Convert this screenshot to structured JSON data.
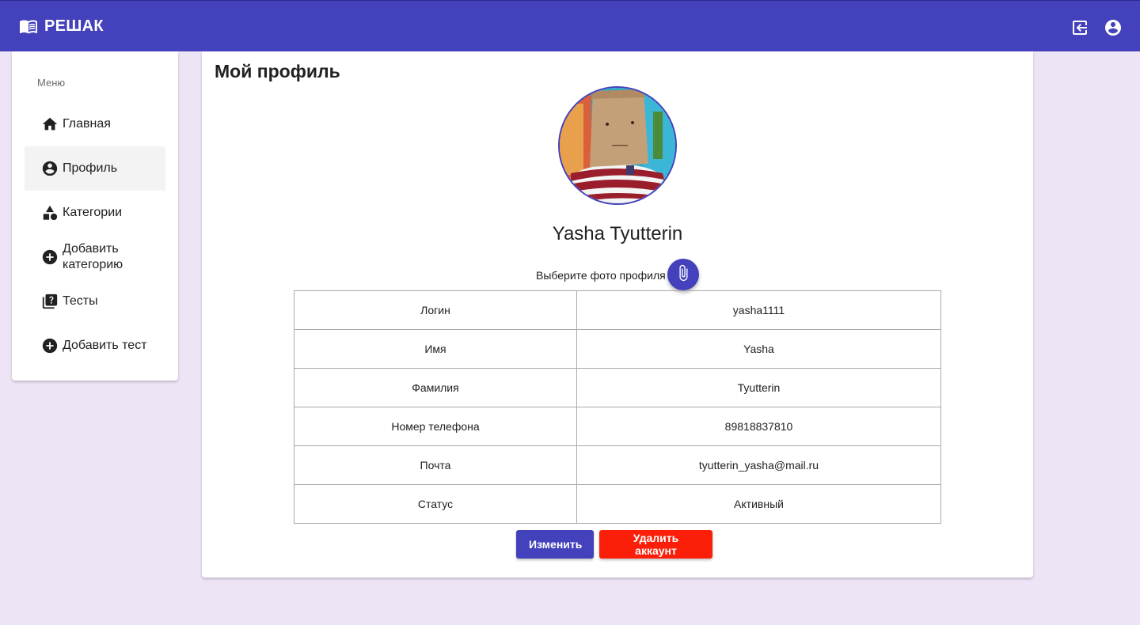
{
  "app": {
    "title": "РЕШАК",
    "brand_icon": "book-open-icon",
    "accent_color": "#4341bb",
    "danger_color": "#fb1f0a",
    "background_color": "#ede4f6"
  },
  "header": {
    "actions": [
      {
        "icon": "logout-icon"
      },
      {
        "icon": "account-circle-icon"
      }
    ]
  },
  "sidebar": {
    "menu_title": "Меню",
    "items": [
      {
        "label": "Главная",
        "icon": "home-icon",
        "active": false
      },
      {
        "label": "Профиль",
        "icon": "account-circle-icon",
        "active": true
      },
      {
        "label": "Категории",
        "icon": "category-icon",
        "active": false
      },
      {
        "label": "Добавить категорию",
        "icon": "add-circle-icon",
        "active": false
      },
      {
        "label": "Тесты",
        "icon": "quiz-icon",
        "active": false
      },
      {
        "label": "Добавить тест",
        "icon": "add-circle-icon",
        "active": false
      }
    ]
  },
  "profile": {
    "page_title": "Мой профиль",
    "full_name": "Yasha Tyutterin",
    "photo_label": "Выберите фото профиля",
    "attach_icon": "paperclip-icon",
    "fields": [
      {
        "label": "Логин",
        "value": "yasha1111"
      },
      {
        "label": "Имя",
        "value": "Yasha"
      },
      {
        "label": "Фамилия",
        "value": "Tyutterin"
      },
      {
        "label": "Номер телефона",
        "value": "89818837810"
      },
      {
        "label": "Почта",
        "value": "tyutterin_yasha@mail.ru"
      },
      {
        "label": "Статус",
        "value": "Активный"
      }
    ],
    "edit_label": "Изменить",
    "delete_label": "Удалить аккаунт"
  }
}
